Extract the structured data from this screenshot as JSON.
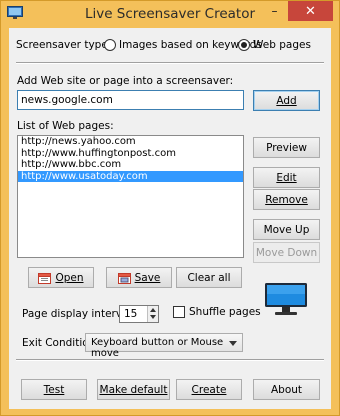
{
  "window": {
    "title": "Live Screensaver Creator"
  },
  "type_row": {
    "label": "Screensaver type:",
    "option_keywords": "Images based on keywords",
    "option_webpages": "Web pages",
    "selected": "Web pages"
  },
  "add_site": {
    "label": "Add Web site or page into a screensaver:",
    "value": "news.google.com",
    "add_label": "Add"
  },
  "list": {
    "label": "List of Web pages:",
    "items": [
      "http://news.yahoo.com",
      "http://www.huffingtonpost.com",
      "http://www.bbc.com",
      "http://www.usatoday.com"
    ],
    "selected_index": 3
  },
  "side_buttons": {
    "preview": "Preview",
    "edit": "Edit",
    "remove": "Remove",
    "move_up": "Move Up",
    "move_down": "Move Down"
  },
  "list_buttons": {
    "open": "Open",
    "save": "Save",
    "clear_all": "Clear all"
  },
  "interval": {
    "label": "Page display interval:",
    "value": "15",
    "shuffle_label": "Shuffle pages"
  },
  "exit": {
    "label": "Exit Condition:",
    "value": "Keyboard button or Mouse move"
  },
  "footer": {
    "test": "Test",
    "make_default": "Make default",
    "create": "Create",
    "about": "About"
  },
  "colors": {
    "title_bar": "#f4c05a",
    "close_button": "#c7463b",
    "selection": "#3399ff",
    "focus_border": "#3c7fb1"
  },
  "icons": [
    "app-icon",
    "close-icon",
    "open-folder-icon",
    "save-icon",
    "monitor-icon"
  ]
}
